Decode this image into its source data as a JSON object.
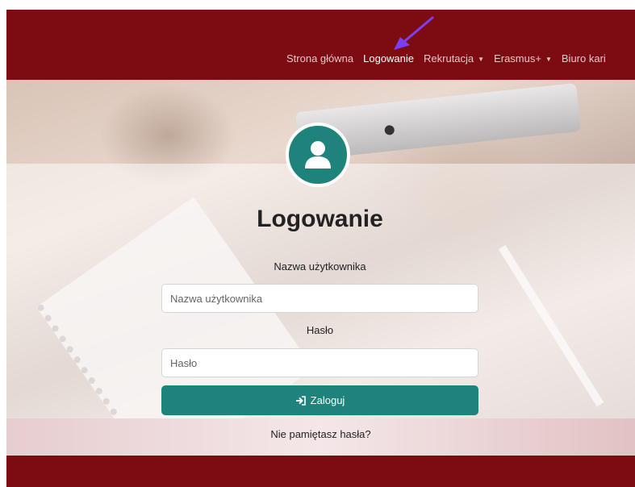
{
  "navbar": {
    "items": [
      {
        "label": "Strona główna",
        "dropdown": false
      },
      {
        "label": "Logowanie",
        "dropdown": false,
        "active": true
      },
      {
        "label": "Rekrutacja",
        "dropdown": true
      },
      {
        "label": "Erasmus+",
        "dropdown": true
      },
      {
        "label": "Biuro kari",
        "dropdown": false
      }
    ],
    "caret": "▼"
  },
  "login": {
    "title": "Logowanie",
    "username_label": "Nazwa użytkownika",
    "username_placeholder": "Nazwa użytkownika",
    "password_label": "Hasło",
    "password_placeholder": "Hasło",
    "submit_label": "Zaloguj",
    "forgot_label": "Nie pamiętasz hasła?"
  },
  "icons": {
    "avatar": "user-icon",
    "submit": "sign-in-icon",
    "annotation": "arrow-icon"
  },
  "colors": {
    "brand": "#7d0b12",
    "accent": "#1e837b",
    "annotation_arrow": "#7b3ff2"
  }
}
